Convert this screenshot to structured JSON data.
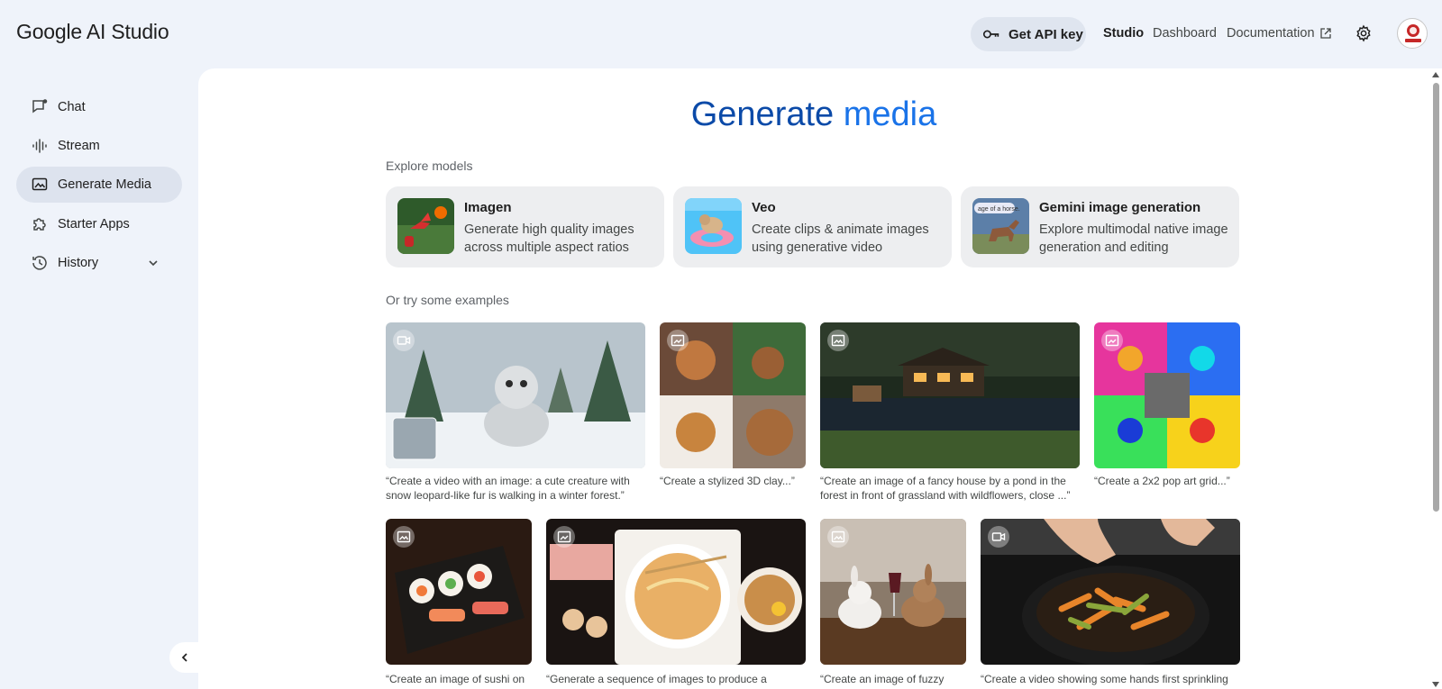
{
  "header": {
    "logo": "Google AI Studio",
    "api_key_label": "Get API key",
    "nav": {
      "studio": "Studio",
      "dashboard": "Dashboard",
      "documentation": "Documentation"
    }
  },
  "sidebar": {
    "items": [
      {
        "label": "Chat",
        "icon": "chat-icon"
      },
      {
        "label": "Stream",
        "icon": "stream-icon"
      },
      {
        "label": "Generate Media",
        "icon": "media-icon",
        "active": true
      },
      {
        "label": "Starter Apps",
        "icon": "puzzle-icon"
      },
      {
        "label": "History",
        "icon": "history-icon",
        "expandable": true
      }
    ]
  },
  "main": {
    "title_part1": "Generate",
    "title_part2": "media",
    "explore_label": "Explore models",
    "models": [
      {
        "name": "Imagen",
        "description": "Generate high quality images across multiple aspect ratios"
      },
      {
        "name": "Veo",
        "description": "Create clips & animate images using generative video"
      },
      {
        "name": "Gemini image generation",
        "description": "Explore multimodal native image generation and editing",
        "thumb_text": "age of a horse."
      }
    ],
    "examples_label": "Or try some examples",
    "examples": [
      {
        "caption": "“Create a video with an image: a cute creature with snow leopard-like fur is walking in a winter forest.”",
        "badge": "video-icon"
      },
      {
        "caption": "“Create a stylized 3D clay...”",
        "badge": "image-edit-icon"
      },
      {
        "caption": "“Create an image of a fancy house by a pond in the forest in front of grassland with wildflowers, close ...”",
        "badge": "image-icon"
      },
      {
        "caption": "“Create a 2x2 pop art grid...”",
        "badge": "image-edit-icon"
      },
      {
        "caption": "“Create an image of sushi on",
        "badge": "image-icon"
      },
      {
        "caption": "“Generate a sequence of images to produce a",
        "badge": "image-edit-icon"
      },
      {
        "caption": "“Create an image of fuzzy",
        "badge": "image-icon"
      },
      {
        "caption": "“Create a video showing some hands first sprinkling",
        "badge": "video-icon"
      }
    ]
  },
  "colors": {
    "accent": "#0b57d0",
    "sidebar_active": "#dde3ee",
    "page_bg": "#eff3fa"
  }
}
